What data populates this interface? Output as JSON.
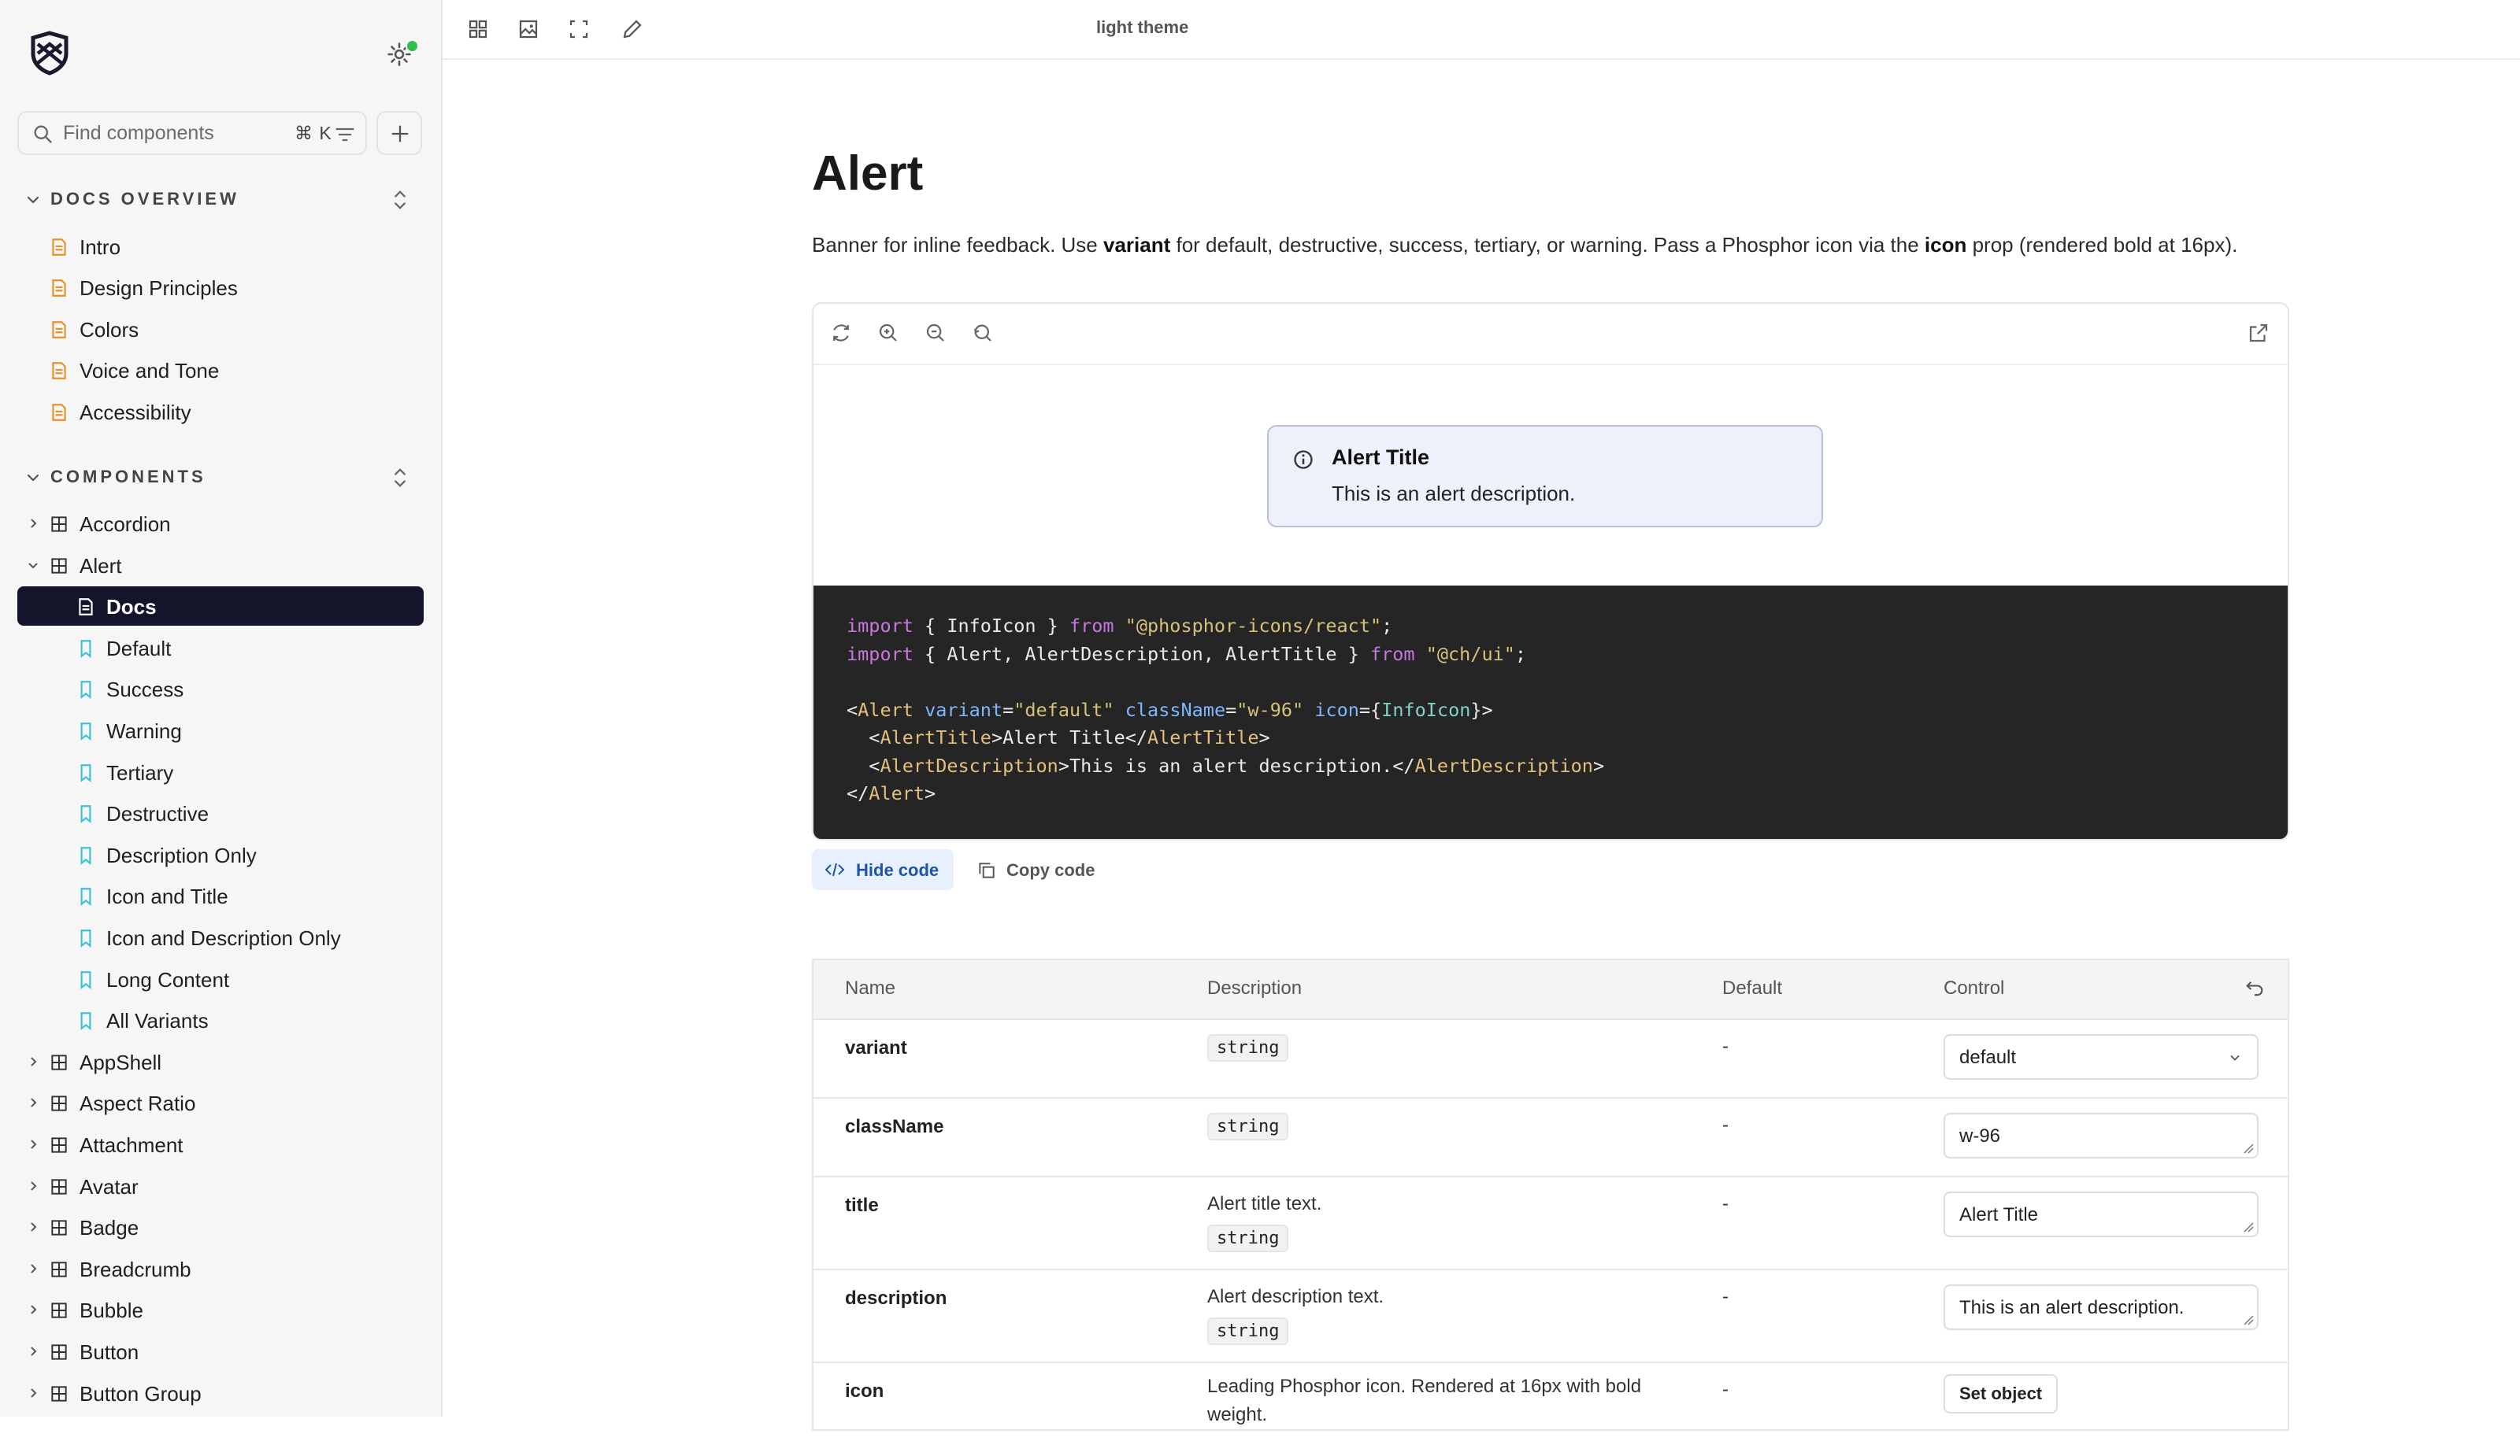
{
  "sidebar": {
    "search_placeholder": "Find components",
    "search_shortcut": "⌘ K",
    "sections": [
      {
        "title": "DOCS OVERVIEW",
        "items": [
          "Intro",
          "Design Principles",
          "Colors",
          "Voice and Tone",
          "Accessibility"
        ]
      },
      {
        "title": "COMPONENTS"
      }
    ],
    "components": [
      {
        "label": "Accordion"
      },
      {
        "label": "Alert"
      },
      {
        "label": "Docs"
      },
      {
        "label": "Default"
      },
      {
        "label": "Success"
      },
      {
        "label": "Warning"
      },
      {
        "label": "Tertiary"
      },
      {
        "label": "Destructive"
      },
      {
        "label": "Description Only"
      },
      {
        "label": "Icon and Title"
      },
      {
        "label": "Icon and Description Only"
      },
      {
        "label": "Long Content"
      },
      {
        "label": "All Variants"
      },
      {
        "label": "AppShell"
      },
      {
        "label": "Aspect Ratio"
      },
      {
        "label": "Attachment"
      },
      {
        "label": "Avatar"
      },
      {
        "label": "Badge"
      },
      {
        "label": "Breadcrumb"
      },
      {
        "label": "Bubble"
      },
      {
        "label": "Button"
      },
      {
        "label": "Button Group"
      }
    ]
  },
  "toolbar": {
    "theme_label": "light theme"
  },
  "main": {
    "title": "Alert",
    "description": {
      "p1": "Banner for inline feedback. Use ",
      "b1": "variant",
      "p2": " for default, destructive, success, tertiary, or warning. Pass a Phosphor icon via the ",
      "b2": "icon",
      "p3": " prop (rendered bold at 16px)."
    },
    "preview": {
      "alert_title": "Alert Title",
      "alert_description": "This is an alert description."
    },
    "code_lines": [
      "import { InfoIcon } from \"@phosphor-icons/react\";",
      "import { Alert, AlertDescription, AlertTitle } from \"@ch/ui\";",
      "",
      "<Alert variant=\"default\" className=\"w-96\" icon={InfoIcon}>",
      "  <AlertTitle>Alert Title</AlertTitle>",
      "  <AlertDescription>This is an alert description.</AlertDescription>",
      "</Alert>"
    ],
    "hide_code_label": "Hide code",
    "copy_code_label": "Copy code"
  },
  "props_table": {
    "headers": [
      "Name",
      "Description",
      "Default",
      "Control"
    ],
    "rows": [
      {
        "name": "variant",
        "description": "",
        "type": "string",
        "default": "-",
        "control": "default"
      },
      {
        "name": "className",
        "description": "",
        "type": "string",
        "default": "-",
        "control": "w-96"
      },
      {
        "name": "title",
        "description": "Alert title text.",
        "type": "string",
        "default": "-",
        "control": "Alert Title"
      },
      {
        "name": "description",
        "description": "Alert description text.",
        "type": "string",
        "default": "-",
        "control": "This is an alert description."
      },
      {
        "name": "icon",
        "description": "Leading Phosphor icon. Rendered at 16px with bold weight.",
        "type": "",
        "default": "-",
        "control": "Set object"
      }
    ]
  },
  "colors": {
    "active_nav_bg": "#14142a",
    "doc_icon": "#e8912a",
    "story_icon": "#3ec3d2",
    "accent_blue": "#1d55a8"
  }
}
